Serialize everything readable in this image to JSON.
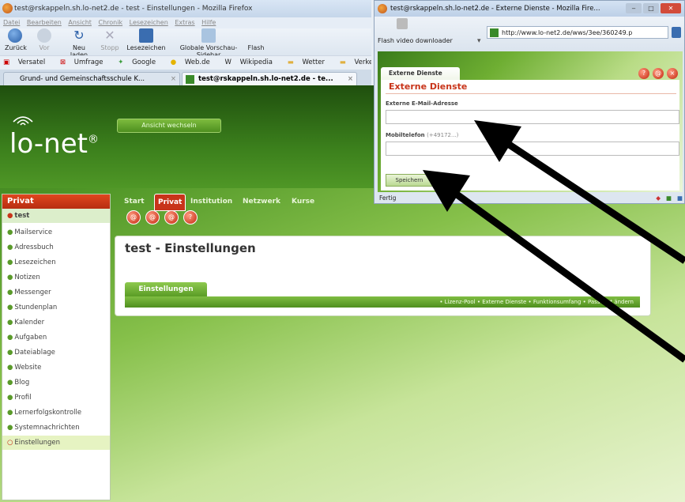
{
  "main_window": {
    "title": "test@rskappeln.sh.lo-net2.de - test - Einstellungen - Mozilla Firefox",
    "menu": [
      "Datei",
      "Bearbeiten",
      "Ansicht",
      "Chronik",
      "Lesezeichen",
      "Extras",
      "Hilfe"
    ],
    "toolbar": {
      "back": "Zurück",
      "forward": "Vor",
      "reload": "Neu laden",
      "stop": "Stopp",
      "bookmarks": "Lesezeichen",
      "sidebar": "Globale Vorschau-Sidebar",
      "flash": "Flash"
    },
    "bookmarks": [
      "Versatel",
      "Umfrage",
      "Google",
      "Web.de",
      "Wikipedia",
      "Wetter",
      "Verkehr"
    ],
    "tabs": [
      {
        "label": "Grund- und Gemeinschaftsschule K..."
      },
      {
        "label": "test@rskappeln.sh.lo-net2.de - te..."
      }
    ]
  },
  "site": {
    "logo_text": "lo-net",
    "logo_sup": "®",
    "view_switch": "Ansicht wechseln",
    "nav": [
      "Start",
      "Privat",
      "Institution",
      "Netzwerk",
      "Kurse"
    ],
    "icon_row": [
      "@",
      "@",
      "@",
      "?"
    ],
    "sidebar_title": "Privat",
    "sidebar_items": [
      "test",
      "Mailservice",
      "Adressbuch",
      "Lesezeichen",
      "Notizen",
      "Messenger",
      "Stundenplan",
      "Kalender",
      "Aufgaben",
      "Dateiablage",
      "Website",
      "Blog",
      "Profil",
      "Lernerfolgskontrolle",
      "Systemnachrichten",
      "Einstellungen"
    ],
    "content_title": "test - Einstellungen",
    "content_tab": "Einstellungen",
    "content_links": "• Lizenz-Pool   • Externe Dienste   • Funktionsumfang   • Passwort ändern"
  },
  "popup": {
    "title": "test@rskappeln.sh.lo-net2.de - Externe Dienste - Mozilla Fire...",
    "flash_label": "Flash video downloader",
    "url": "http://www.lo-net2.de/wws/3ee/360249.p",
    "tab_label": "Externe Dienste",
    "form_title": "Externe Dienste",
    "email_label": "Externe E-Mail-Adresse",
    "email_value": "",
    "mobile_label": "Mobiltelefon",
    "mobile_hint": "(+49172...)",
    "mobile_value": "",
    "save_button": "Speichern",
    "status": "Fertig"
  },
  "colors": {
    "accent_red": "#c8341a",
    "site_green": "#4f9726",
    "annotation_arrow": "#000000"
  }
}
